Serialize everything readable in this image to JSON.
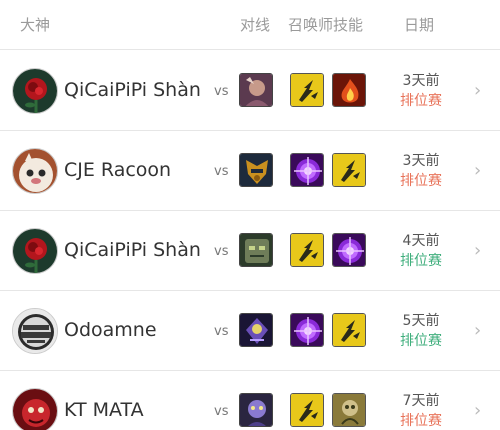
{
  "header": {
    "player": "大神",
    "opponent": "对线",
    "spells": "召唤师技能",
    "date": "日期"
  },
  "vs_label": "vs",
  "mode_colors": {
    "排位赛_orange": "#e8735a",
    "排位赛_green": "#3fae7c"
  },
  "rows": [
    {
      "name": "QiCaiPiPi Shàn",
      "date": "3天前",
      "mode": "排位赛",
      "mode_color": "#e8735a",
      "avatar": "rose-avatar",
      "champion": "champion-portrait",
      "spells": [
        "flash-icon",
        "ignite-icon"
      ]
    },
    {
      "name": "CJE Racoon",
      "date": "3天前",
      "mode": "排位赛",
      "mode_color": "#e8735a",
      "avatar": "poro-avatar",
      "champion": "champion-portrait",
      "spells": [
        "teleport-icon",
        "flash-icon"
      ]
    },
    {
      "name": "QiCaiPiPi Shàn",
      "date": "4天前",
      "mode": "排位赛",
      "mode_color": "#3fae7c",
      "avatar": "rose-avatar",
      "champion": "champion-portrait",
      "spells": [
        "flash-icon",
        "teleport-icon"
      ]
    },
    {
      "name": "Odoamne",
      "date": "5天前",
      "mode": "排位赛",
      "mode_color": "#3fae7c",
      "avatar": "lol-logo-avatar",
      "champion": "champion-portrait",
      "spells": [
        "teleport-icon",
        "flash-icon"
      ]
    },
    {
      "name": "KT MATA",
      "date": "7天前",
      "mode": "排位赛",
      "mode_color": "#e8735a",
      "avatar": "red-avatar",
      "champion": "champion-portrait",
      "spells": [
        "flash-icon",
        "exhaust-icon"
      ]
    }
  ]
}
